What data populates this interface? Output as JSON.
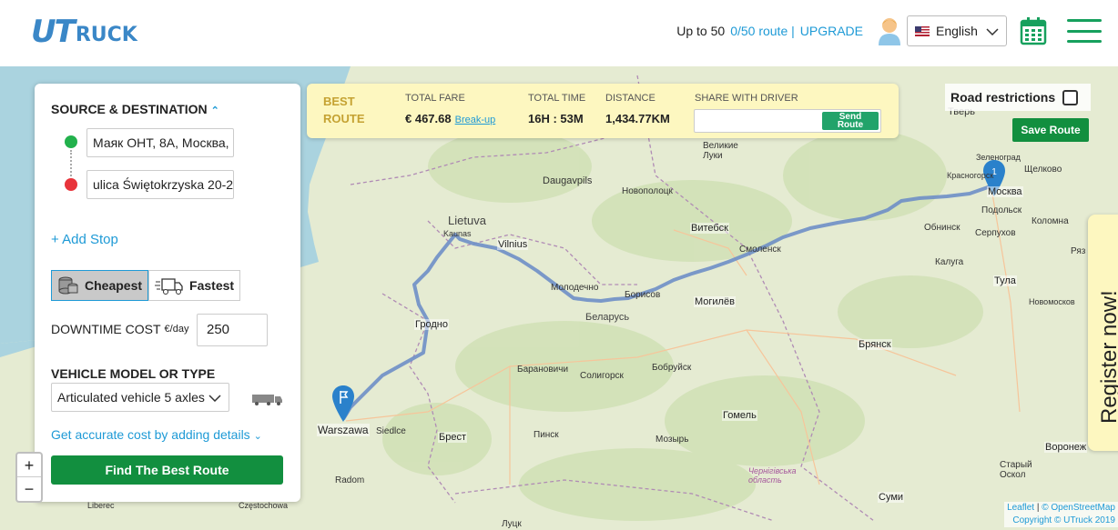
{
  "header": {
    "logo_ut": "UT",
    "logo_ruck": "RUCK",
    "up_to": "Up to 50",
    "route_count": "0/50 route |",
    "upgrade": "UPGRADE",
    "language": "English"
  },
  "panel": {
    "title": "SOURCE & DESTINATION",
    "source": "Маяк ОНТ, 8А, Москва, Р",
    "destination": "ulica Świętokrzyska 20-2",
    "add_stop": "+ Add Stop",
    "mode_cheapest": "Cheapest",
    "mode_fastest": "Fastest",
    "downtime_label": "DOWNTIME COST",
    "downtime_unit": "€/day",
    "downtime_value": "250",
    "vehicle_title": "VEHICLE MODEL OR TYPE",
    "vehicle_value": "Articulated vehicle 5 axles",
    "accurate_link": "Get accurate cost by adding details",
    "find_button": "Find The Best Route"
  },
  "zoom": {
    "in": "+",
    "out": "−"
  },
  "best_route": {
    "title_line1": "BEST",
    "title_line2": "ROUTE",
    "fare_label": "TOTAL FARE",
    "fare_value": "€ 467.68",
    "breakup": "Break-up",
    "time_label": "TOTAL TIME",
    "time_value": "16H : 53M",
    "distance_label": "DISTANCE",
    "distance_value": "1,434.77KM",
    "share_label": "SHARE WITH DRIVER",
    "send_line1": "Send",
    "send_line2": "Route"
  },
  "map_controls": {
    "road_restrictions": "Road restrictions",
    "save_route": "Save Route",
    "register": "Register now!",
    "attribution_leaflet": "Leaflet",
    "attribution_osm": "© OpenStreetMap",
    "copyright": "Copyright © UTruck 2019"
  },
  "map_labels": {
    "lietuva": "Lietuva",
    "vilnius": "Vilnius",
    "kaunas": "Kaunas",
    "daugavpils": "Daugavpils",
    "vitebsk": "Витебск",
    "smolensk": "Смоленск",
    "moskva": "Москва",
    "podolsk": "Подольск",
    "kolomna": "Коломна",
    "serpukhov": "Серпухов",
    "obninsk": "Обнинск",
    "kaluga": "Калуга",
    "tula": "Тула",
    "bryansk": "Брянск",
    "belarus": "Беларусь",
    "mogilev": "Могилёв",
    "borisov": "Борисов",
    "molodechno": "Молодечно",
    "grodno": "Гродно",
    "baranovichi": "Барановичи",
    "soligorsk": "Солигорск",
    "bobruisk": "Бобруйск",
    "gomel": "Гомель",
    "mozyr": "Мозырь",
    "pinsk": "Пинск",
    "brest": "Брест",
    "warszawa": "Warszawa",
    "siedlce": "Siedlce",
    "radom": "Radom",
    "novopolotsk": "Новополоцк",
    "velikie_luki": "Великие Луки",
    "tver": "Тверь",
    "zelenograd": "Зеленоград",
    "krasnogorsk": "Красногорск",
    "shchelkovo": "Щелково",
    "voronezh": "Воронеж",
    "sumy": "Суми",
    "novomoskovsk": "Новомосков",
    "staryi_oskol": "Старый Оскол",
    "chernihiv": "Чернігівська область",
    "liberec": "Liberec",
    "czestochowa": "Częstochowa",
    "lutsk": "Луцк",
    "ryazan": "Ряз"
  },
  "route_marker_number": "1",
  "colors": {
    "green": "#128f3f",
    "blue": "#1e9ad6",
    "route": "#6e8fc7",
    "best_bg": "#fdf7c0"
  }
}
